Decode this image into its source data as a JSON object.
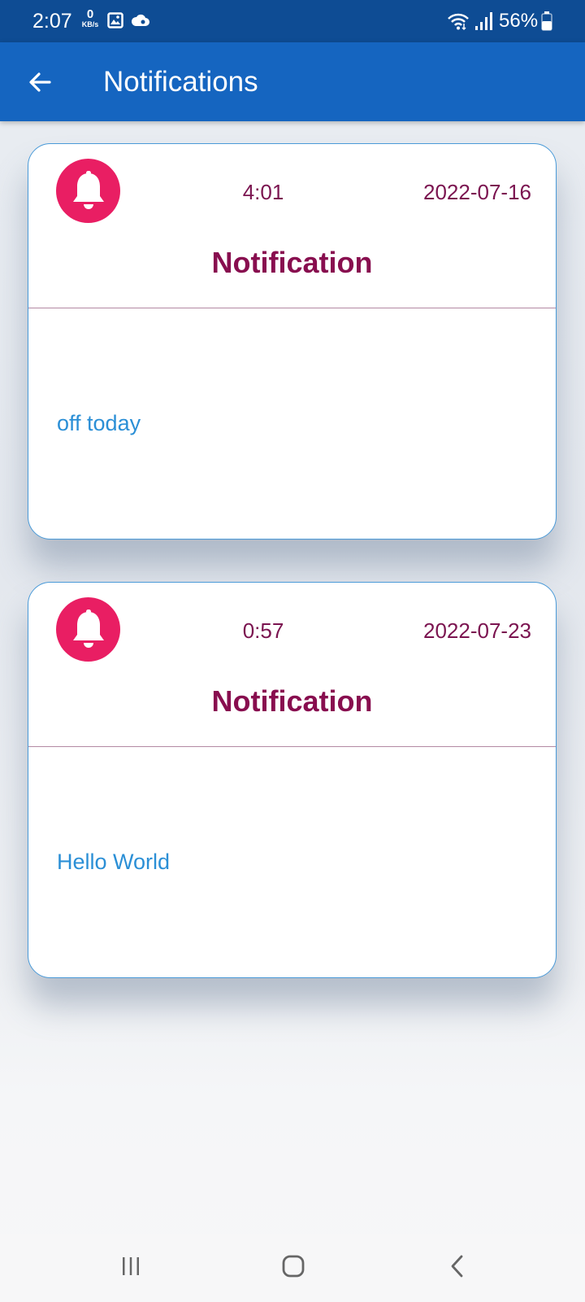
{
  "status_bar": {
    "time": "2:07",
    "net_speed_value": "0",
    "net_speed_unit": "KB/s",
    "battery_text": "56%",
    "icons": [
      "gallery-icon",
      "cloud-icon",
      "wifi-icon",
      "signal-icon",
      "battery-icon"
    ]
  },
  "app_bar": {
    "title": "Notifications",
    "back_icon": "arrow-left-icon"
  },
  "notifications": [
    {
      "icon": "bell-icon",
      "time": "4:01",
      "date": "2022-07-16",
      "title": "Notification",
      "message": "off today"
    },
    {
      "icon": "bell-icon",
      "time": "0:57",
      "date": "2022-07-23",
      "title": "Notification",
      "message": "Hello World"
    }
  ],
  "nav_bar": {
    "icons": [
      "recents-icon",
      "home-icon",
      "back-icon"
    ]
  },
  "colors": {
    "status_bar": "#0e4c94",
    "app_bar": "#1565c0",
    "card_border": "#4a9ad8",
    "bell_badge": "#e91e63",
    "card_title": "#880e4f",
    "card_meta": "#7b1450",
    "message": "#2b8fd6"
  }
}
